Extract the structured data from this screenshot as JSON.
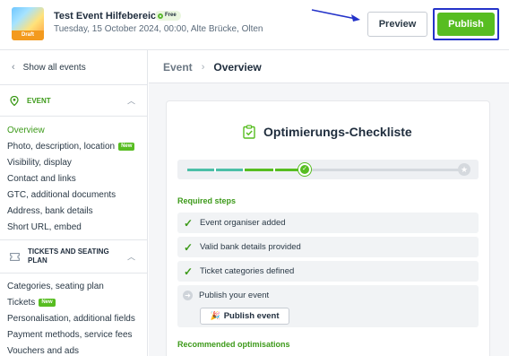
{
  "header": {
    "thumbnail_badge": "Draft",
    "event_title": "Test Event Hilfebereich",
    "price_badge": "Free",
    "event_meta": "Tuesday, 15 October 2024, 00:00, Alte Brücke, Olten",
    "preview_label": "Preview",
    "publish_label": "Publish",
    "publish_color": "#57bd21",
    "highlight_color": "#2433c9"
  },
  "sidebar": {
    "back_label": "Show all events",
    "event_section": {
      "title": "EVENT",
      "icon": "location-pin-icon",
      "items": [
        {
          "label": "Overview",
          "badge": ""
        },
        {
          "label": "Photo, description, location",
          "badge": "New"
        },
        {
          "label": "Visibility, display",
          "badge": ""
        },
        {
          "label": "Contact and links",
          "badge": ""
        },
        {
          "label": "GTC, additional documents",
          "badge": ""
        },
        {
          "label": "Address, bank details",
          "badge": ""
        },
        {
          "label": "Short URL, embed",
          "badge": ""
        }
      ]
    },
    "tickets_section": {
      "title": "TICKETS AND SEATING PLAN",
      "icon": "ticket-icon",
      "items": [
        {
          "label": "Categories, seating plan",
          "badge": ""
        },
        {
          "label": "Tickets",
          "badge": "New"
        },
        {
          "label": "Personalisation, additional fields",
          "badge": ""
        },
        {
          "label": "Payment methods, service fees",
          "badge": ""
        },
        {
          "label": "Vouchers and ads",
          "badge": ""
        }
      ]
    }
  },
  "main": {
    "breadcrumb": {
      "parent": "Event",
      "current": "Overview"
    },
    "checklist": {
      "title": "Optimierungs-Checkliste",
      "progress_steps_done": 3,
      "progress_steps_total": 4,
      "required_heading": "Required steps",
      "steps": [
        {
          "label": "Event organiser added",
          "done": true
        },
        {
          "label": "Valid bank details provided",
          "done": true
        },
        {
          "label": "Ticket categories defined",
          "done": true
        }
      ],
      "open_step": {
        "label": "Publish your event",
        "button": "Publish event"
      },
      "recommended_heading": "Recommended optimisations"
    }
  }
}
